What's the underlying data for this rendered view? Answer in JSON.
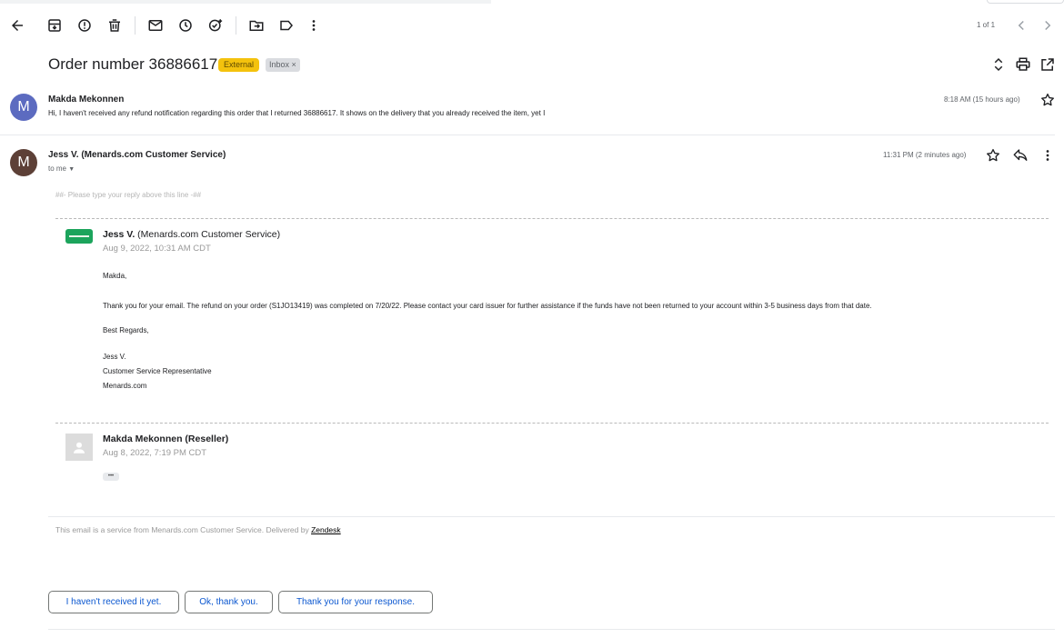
{
  "toolbar": {
    "pagination": "1 of 1"
  },
  "subject": "Order number 36886617",
  "labels": {
    "external": "External",
    "inbox": "Inbox ×"
  },
  "message1": {
    "avatar_letter": "M",
    "avatar_color": "#5c6bc0",
    "sender": "Makda Mekonnen",
    "snippet": "Hi, I haven't received any refund notification regarding this order that I returned 36886617. It shows on the delivery that you already received the item, yet I",
    "time": "8:18 AM (15 hours ago)"
  },
  "message2": {
    "avatar_letter": "M",
    "avatar_color": "#5d4037",
    "sender": "Jess V. (Menards.com Customer Service)",
    "to": "to me",
    "time": "11:31 PM (2 minutes ago)",
    "reply_line": "##- Please type your reply above this line -##",
    "zd1": {
      "name_bold": "Jess V.",
      "name_rest": " (Menards.com Customer Service)",
      "date": "Aug 9, 2022, 10:31 AM CDT",
      "logo_color": "#1ca45c",
      "greeting": "Makda,",
      "body": "Thank you for your email. The refund on your order (S1JO13419) was completed on 7/20/22. Please contact your card issuer for further assistance if the funds have not been returned to your account within 3-5 business days from that date.",
      "closing": "Best Regards,",
      "sig1": "Jess V.",
      "sig2": "Customer Service Representative",
      "sig3": "Menards.com"
    },
    "zd2": {
      "name": "Makda Mekonnen (Reseller)",
      "date": "Aug 8, 2022, 7:19 PM CDT",
      "more": "•••"
    },
    "footer_text": "This email is a service from Menards.com Customer Service. Delivered by ",
    "footer_link": "Zendesk"
  },
  "smart_replies": [
    "I haven't received it yet.",
    "Ok, thank you.",
    "Thank you for your response."
  ]
}
